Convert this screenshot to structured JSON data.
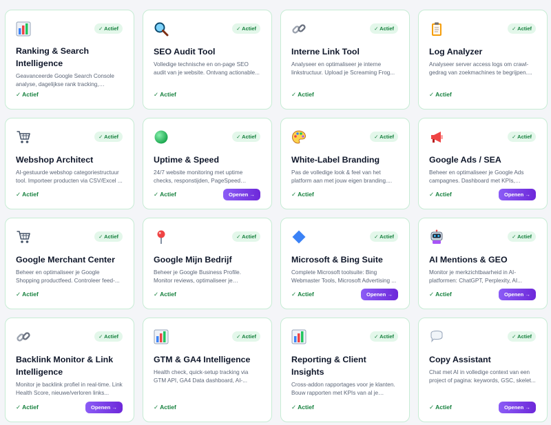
{
  "cards": [
    {
      "icon": "bar-chart",
      "badge": "✓ Actief",
      "title": "Ranking & Search Intelligence",
      "desc": "Geavanceerde Google Search Console analyse, dagelijkse rank tracking, keywor...",
      "status": "✓ Actief",
      "button": null
    },
    {
      "icon": "magnifier",
      "badge": "✓ Actief",
      "title": "SEO Audit Tool",
      "desc": "Volledige technische en on-page SEO audit van je website. Ontvang actionable...",
      "status": "✓ Actief",
      "button": null
    },
    {
      "icon": "link",
      "badge": "✓ Actief",
      "title": "Interne Link Tool",
      "desc": "Analyseer en optimaliseer je interne linkstructuur. Upload je Screaming Frog...",
      "status": "✓ Actief",
      "button": null
    },
    {
      "icon": "clipboard",
      "badge": "✓ Actief",
      "title": "Log Analyzer",
      "desc": "Analyseer server access logs om crawl-gedrag van zoekmachines te begrijpen....",
      "status": "✓ Actief",
      "button": null
    },
    {
      "icon": "shopping-cart",
      "badge": "✓ Actief",
      "title": "Webshop Architect",
      "desc": "AI-gestuurde webshop categoriestructuur tool. Importeer producten via CSV/Excel ...",
      "status": "✓ Actief",
      "button": null
    },
    {
      "icon": "green-circle",
      "badge": "✓ Actief",
      "title": "Uptime & Speed",
      "desc": "24/7 website monitoring met uptime checks, responstijden, PageSpeed score...",
      "status": "✓ Actief",
      "button": "Openen →"
    },
    {
      "icon": "palette",
      "badge": "✓ Actief",
      "title": "White-Label Branding",
      "desc": "Pas de volledige look & feel van het platform aan met jouw eigen branding....",
      "status": "✓ Actief",
      "button": null
    },
    {
      "icon": "megaphone",
      "badge": "✓ Actief",
      "title": "Google Ads / SEA",
      "desc": "Beheer en optimaliseer je Google Ads campagnes. Dashboard met KPIs, verspil...",
      "status": "✓ Actief",
      "button": "Openen →"
    },
    {
      "icon": "shopping-cart",
      "badge": "✓ Actief",
      "title": "Google Merchant Center",
      "desc": "Beheer en optimaliseer je Google Shopping productfeed. Controleer feed-...",
      "status": "✓ Actief",
      "button": null
    },
    {
      "icon": "map-pin",
      "badge": "✓ Actief",
      "title": "Google Mijn Bedrijf",
      "desc": "Beheer je Google Business Profile. Monitor reviews, optimaliseer je bedrijfsprofiel,...",
      "status": "✓ Actief",
      "button": null
    },
    {
      "icon": "blue-diamond",
      "badge": "✓ Actief",
      "title": "Microsoft & Bing Suite",
      "desc": "Complete Microsoft toolsuite: Bing Webmaster Tools, Microsoft Advertising ...",
      "status": "✓ Actief",
      "button": "Openen →"
    },
    {
      "icon": "robot",
      "badge": "✓ Actief",
      "title": "AI Mentions & GEO",
      "desc": "Monitor je merkzichtbaarheid in AI-platformen: ChatGPT, Perplexity, AI...",
      "status": "✓ Actief",
      "button": "Openen →"
    },
    {
      "icon": "link",
      "badge": "✓ Actief",
      "title": "Backlink Monitor & Link Intelligence",
      "desc": "Monitor je backlink profiel in real-time. Link Health Score, nieuwe/verloren links...",
      "status": "✓ Actief",
      "button": "Openen →"
    },
    {
      "icon": "bar-chart",
      "badge": "✓ Actief",
      "title": "GTM & GA4 Intelligence",
      "desc": "Health check, quick-setup tracking via GTM API, GA4 Data dashboard, AI-...",
      "status": "✓ Actief",
      "button": null
    },
    {
      "icon": "bar-chart",
      "badge": "✓ Actief",
      "title": "Reporting & Client Insights",
      "desc": "Cross-addon rapportages voor je klanten. Bouw rapporten met KPIs van al je actiev...",
      "status": "✓ Actief",
      "button": null
    },
    {
      "icon": "speech-bubble",
      "badge": "✓ Actief",
      "title": "Copy Assistant",
      "desc": "Chat met AI in volledige context van een project of pagina: keywords, GSC, skelet...",
      "status": "✓ Actief",
      "button": "Openen →"
    }
  ]
}
